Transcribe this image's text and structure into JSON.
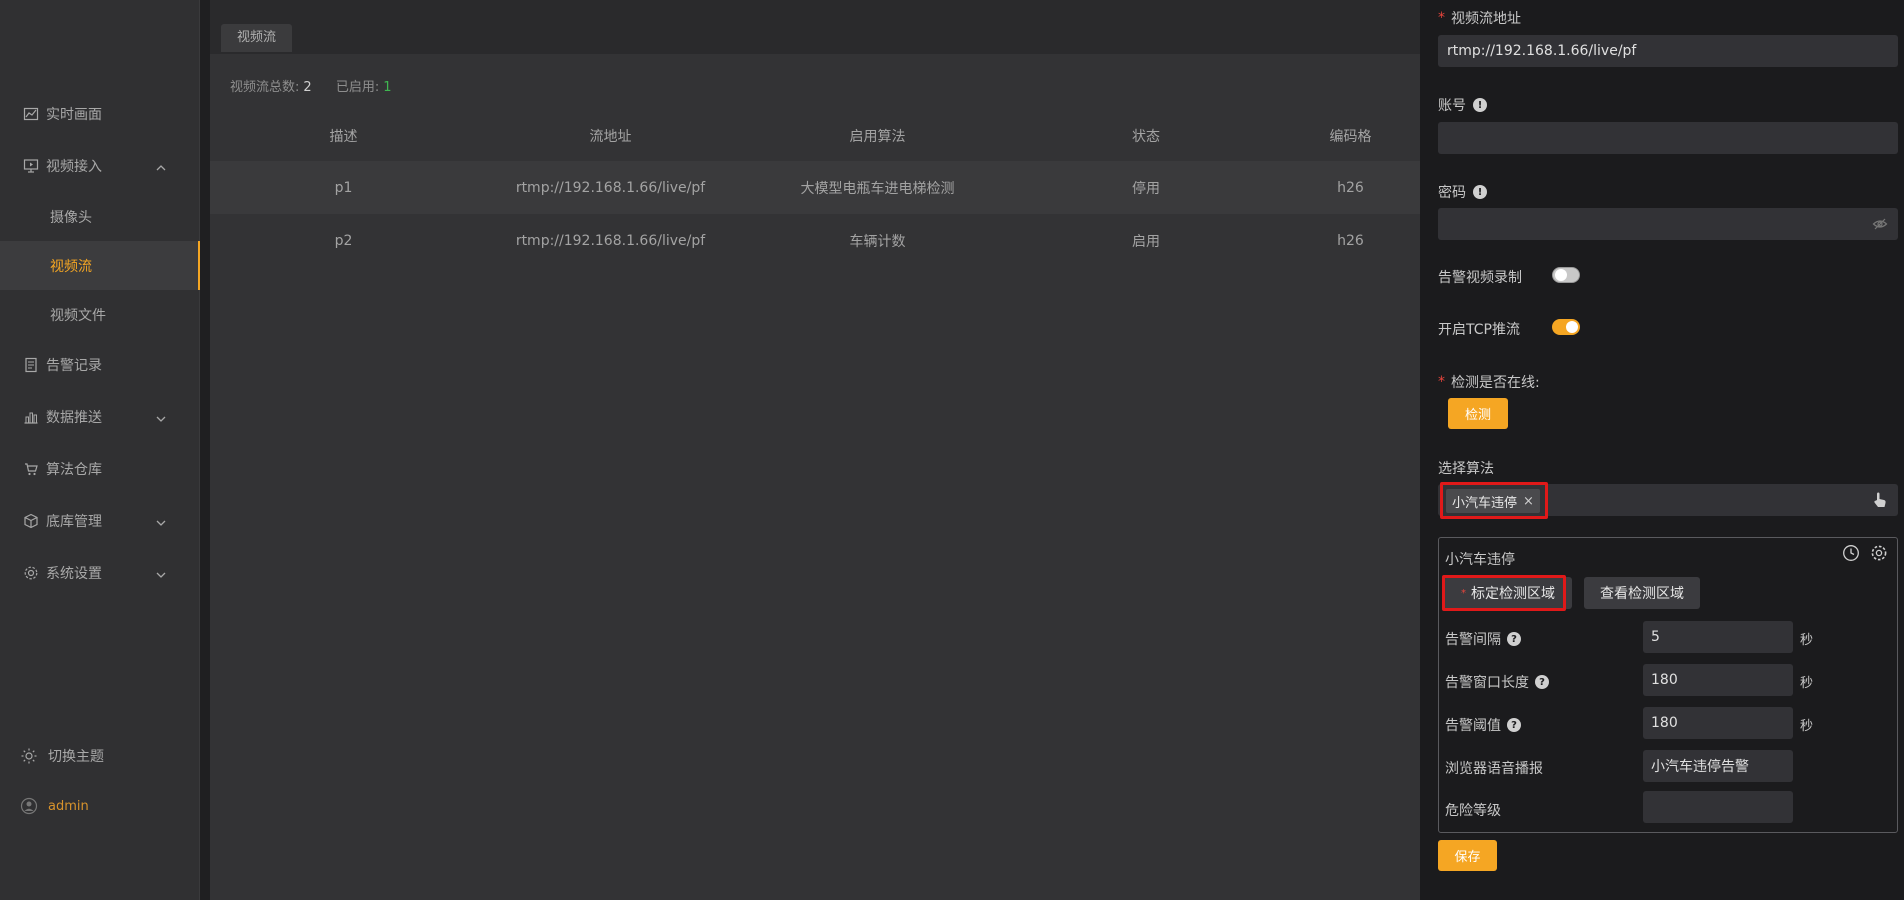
{
  "sidebar": {
    "items": [
      {
        "label": "实时画面",
        "icon": "chart-icon"
      },
      {
        "label": "视频接入",
        "icon": "monitor-icon"
      },
      {
        "label": "告警记录",
        "icon": "document-icon"
      },
      {
        "label": "数据推送",
        "icon": "bar-chart-icon"
      },
      {
        "label": "算法仓库",
        "icon": "cart-icon"
      },
      {
        "label": "底库管理",
        "icon": "box-icon"
      },
      {
        "label": "系统设置",
        "icon": "gear-icon"
      }
    ],
    "sub_items": [
      "摄像头",
      "视频流",
      "视频文件"
    ],
    "theme_label": "切换主题",
    "user_label": "admin"
  },
  "main": {
    "tab_label": "视频流",
    "summary": {
      "total_label": "视频流总数:",
      "total_value": "2",
      "enabled_label": "已启用:",
      "enabled_value": "1"
    },
    "table": {
      "headers": [
        "描述",
        "流地址",
        "启用算法",
        "状态",
        "编码格"
      ],
      "rows": [
        [
          "p1",
          "rtmp://192.168.1.66/live/pf",
          "大模型电瓶车进电梯检测",
          "停用",
          "h26"
        ],
        [
          "p2",
          "rtmp://192.168.1.66/live/pf",
          "车辆计数",
          "启用",
          "h26"
        ]
      ]
    }
  },
  "panel": {
    "stream_url_label": "视频流地址",
    "stream_url_value": "rtmp://192.168.1.66/live/pf",
    "account_label": "账号",
    "password_label": "密码",
    "alarm_record_label": "告警视频录制",
    "tcp_push_label": "开启TCP推流",
    "online_check_label": "检测是否在线:",
    "check_button": "检测",
    "select_algorithm_label": "选择算法",
    "selected_tag": "小汽车违停",
    "algorithm": {
      "title": "小汽车违停",
      "mark_area_button": "标定检测区域",
      "view_area_button": "查看检测区域",
      "interval_label": "告警间隔",
      "interval_value": "5",
      "window_label": "告警窗口长度",
      "window_value": "180",
      "threshold_label": "告警阈值",
      "threshold_value": "180",
      "unit_seconds": "秒",
      "voice_label": "浏览器语音播报",
      "voice_value": "小汽车违停告警",
      "danger_label": "危险等级",
      "danger_value": ""
    },
    "save_button": "保存"
  },
  "colors": {
    "accent": "#f5a623",
    "highlight": "#e01919",
    "enabled_green": "#3fb650"
  }
}
